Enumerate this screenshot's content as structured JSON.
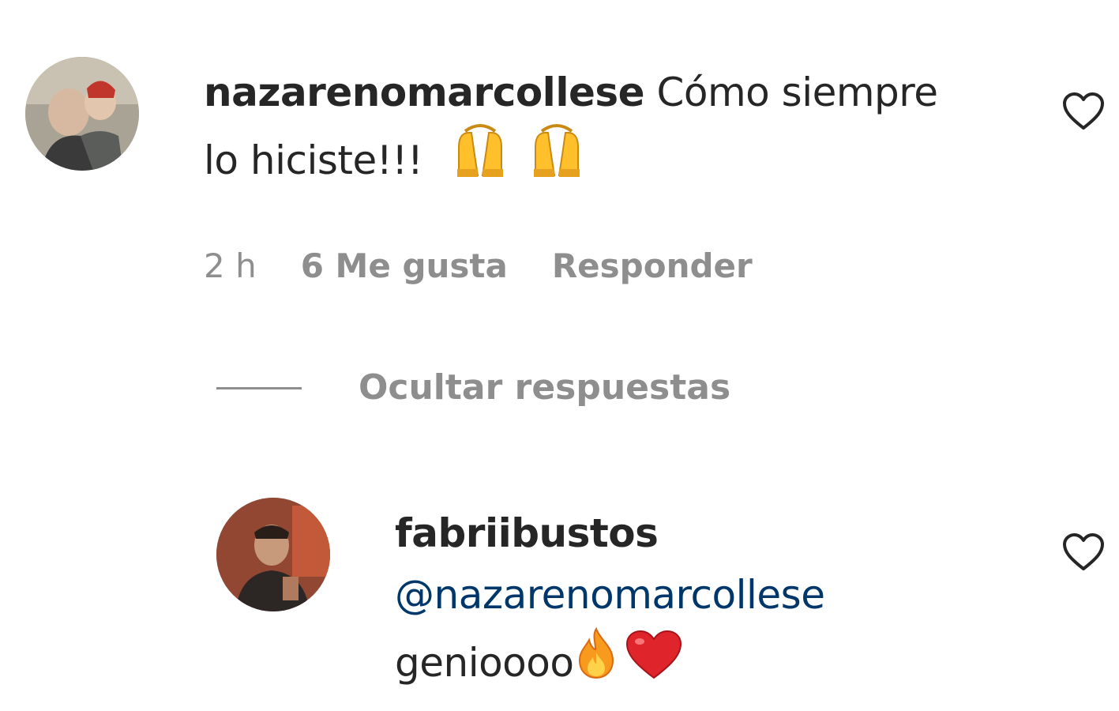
{
  "comment": {
    "username": "nazarenomarcollese",
    "text_line1": "Cómo siempre",
    "text_line2": "lo hiciste!!!",
    "emoji_icons": [
      "raising-hands-icon",
      "raising-hands-icon"
    ],
    "time": "2 h",
    "likes": "6 Me gusta",
    "reply_label": "Responder"
  },
  "replies_toggle": {
    "label": "Ocultar respuestas"
  },
  "reply": {
    "username": "fabriibustos",
    "mention": "@nazarenomarcollese",
    "text": "genioooo",
    "emoji_icons": [
      "fire-icon",
      "red-heart-icon"
    ]
  },
  "colors": {
    "primary_text": "#262626",
    "secondary_text": "#8e8e8e",
    "mention": "#00376b",
    "heart_stroke": "#262626",
    "red_heart": "#e0242c",
    "fire": "#f79a1e",
    "emoji_yellow": "#ffc02b"
  }
}
